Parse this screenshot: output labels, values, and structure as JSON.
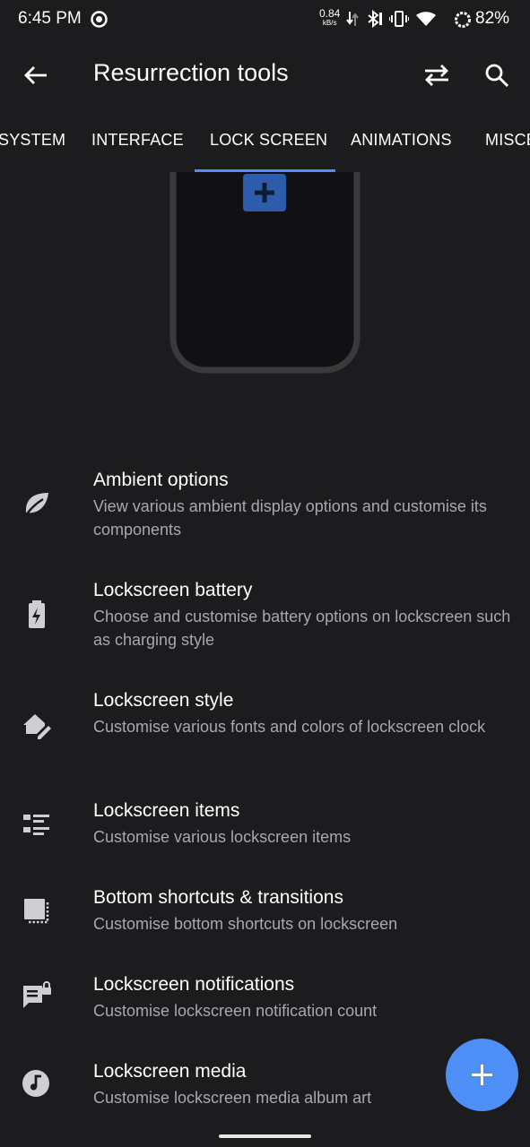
{
  "status_bar": {
    "time": "6:45 PM",
    "net_speed": "0.84",
    "net_unit": "kB/s",
    "battery_percent": "82%",
    "icons": [
      "record-icon",
      "data-arrows-icon",
      "bluetooth-icon",
      "vibrate-icon",
      "wifi-icon",
      "battery-ring-icon"
    ]
  },
  "app_bar": {
    "title": "Resurrection tools",
    "icons": [
      "back-arrow-icon",
      "swap-icon",
      "search-icon"
    ]
  },
  "tabs": [
    {
      "label": "SYSTEM"
    },
    {
      "label": "INTERFACE"
    },
    {
      "label": "LOCK SCREEN",
      "selected": true
    },
    {
      "label": "ANIMATIONS"
    },
    {
      "label": "MISCE"
    }
  ],
  "items": [
    {
      "title": "Ambient options",
      "summary": "View various ambient display options and customise its components",
      "icon": "leaf-icon"
    },
    {
      "title": "Lockscreen battery",
      "summary": "Choose and customise battery options on lockscreen such as charging style",
      "icon": "battery-charging-icon"
    },
    {
      "title": "Lockscreen style",
      "summary": "Customise various fonts and colors of lockscreen clock",
      "icon": "home-edit-icon"
    },
    {
      "title": "Lockscreen items",
      "summary": "Customise various lockscreen items",
      "icon": "list-icon"
    },
    {
      "title": "Bottom shortcuts & transitions",
      "summary": "Customise bottom shortcuts on lockscreen",
      "icon": "shortcuts-icon"
    },
    {
      "title": "Lockscreen notifications",
      "summary": "Customise lockscreen notification count",
      "icon": "notification-lock-icon"
    },
    {
      "title": "Lockscreen media",
      "summary": "Customise lockscreen media album art",
      "icon": "music-note-icon"
    }
  ],
  "fab": {
    "icon": "plus-icon"
  },
  "colors": {
    "background": "#1c1c1e",
    "accent": "#4d8ef7",
    "summary_text": "#a8a8ad",
    "phone_plus": "#2d5cad"
  }
}
